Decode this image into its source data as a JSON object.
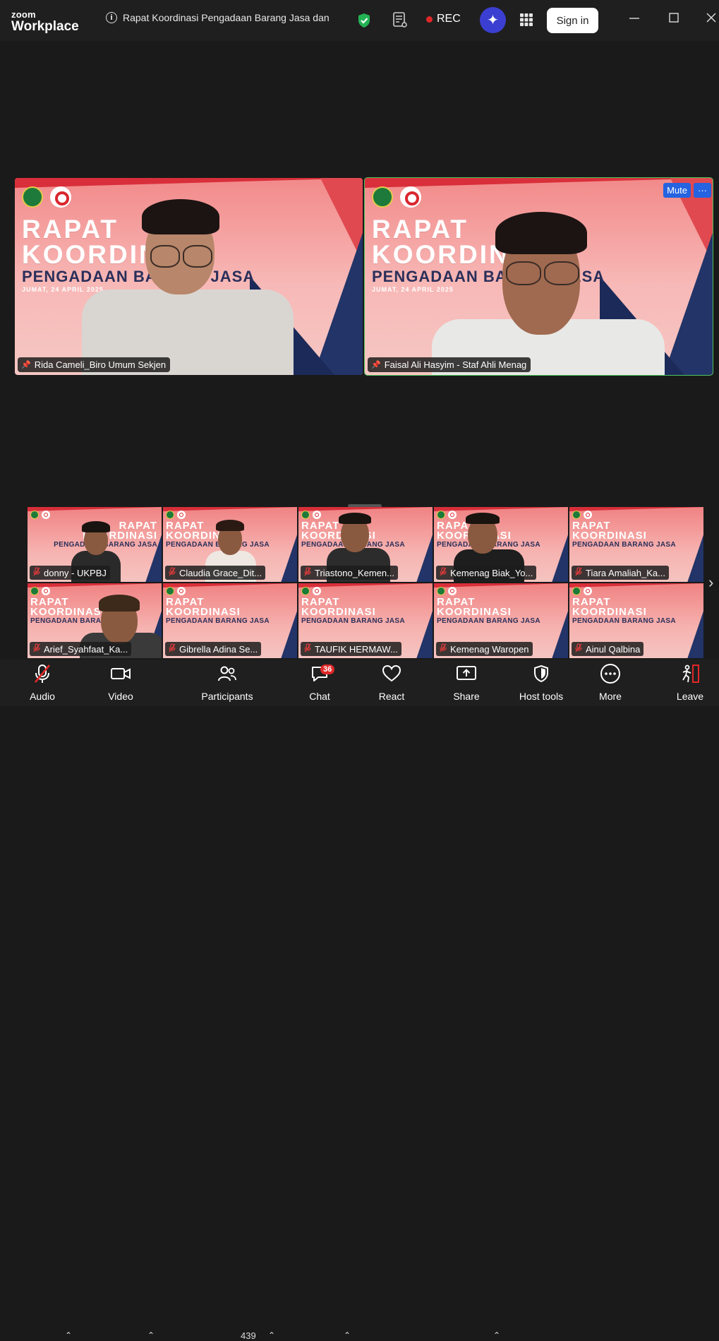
{
  "app": {
    "logo_top": "zoom",
    "logo_bottom": "Workplace"
  },
  "meeting": {
    "title": "Rapat Koordinasi Pengadaan Barang Jasa dan",
    "rec_label": "REC"
  },
  "header": {
    "sign_in": "Sign in"
  },
  "slide": {
    "line1": "RAPAT",
    "line2": "KOORDINASI",
    "line3": "PENGADAAN BARANG JASA",
    "date": "JUMAT, 24 APRIL 2025"
  },
  "main_tiles": [
    {
      "name": "Rida Cameli_Biro Umum Sekjen"
    },
    {
      "name": "Faisal Ali Hasyim - Staf Ahli Menag",
      "mute_label": "Mute",
      "more_label": "···"
    }
  ],
  "gallery": [
    {
      "name": "donny - UKPBJ"
    },
    {
      "name": "Claudia Grace_Dit..."
    },
    {
      "name": "Triastono_Kemen..."
    },
    {
      "name": "Kemenag Biak_Yo..."
    },
    {
      "name": "Tiara Amaliah_Ka..."
    },
    {
      "name": "Arief_Syahfaat_Ka..."
    },
    {
      "name": "Gibrella Adina Se..."
    },
    {
      "name": "TAUFIK HERMAW..."
    },
    {
      "name": "Kemenag Waropen"
    },
    {
      "name": "Ainul Qalbina"
    }
  ],
  "toolbar": {
    "audio": "Audio",
    "video": "Video",
    "participants": "Participants",
    "participant_count": "439",
    "chat": "Chat",
    "chat_badge": "36",
    "react": "React",
    "share": "Share",
    "host_tools": "Host tools",
    "more": "More",
    "leave": "Leave"
  },
  "colors": {
    "accent": "#2563e0",
    "active_speaker": "#4ec55c",
    "rec": "#e02828",
    "slide_navy": "#223468"
  }
}
